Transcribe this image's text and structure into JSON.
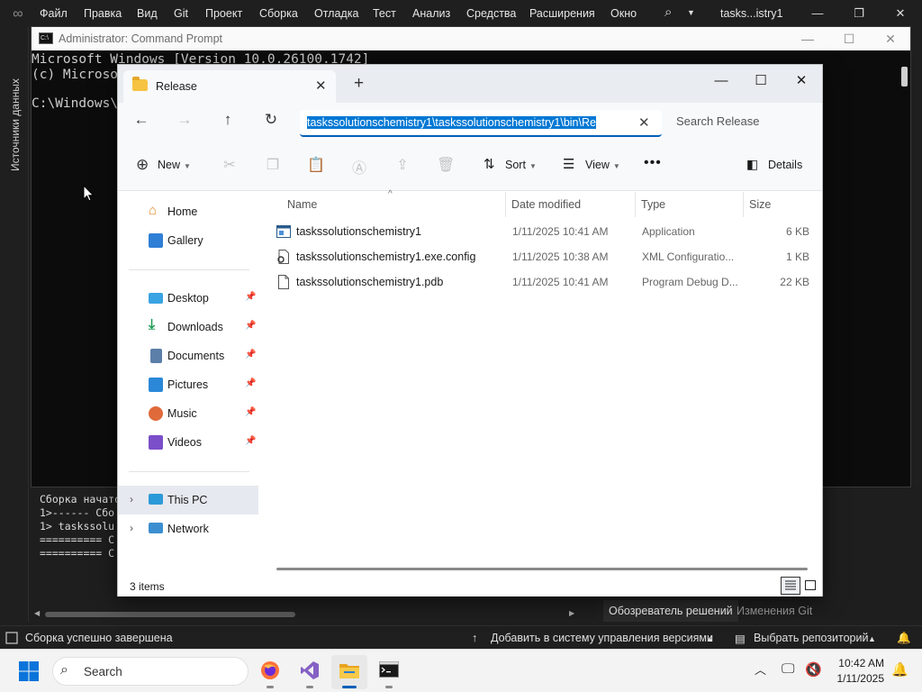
{
  "vs": {
    "menu": [
      "Файл",
      "Правка",
      "Вид",
      "Git",
      "Проект",
      "Сборка",
      "Отладка",
      "Тест",
      "Анализ",
      "Средства",
      "Расширения",
      "Окно"
    ],
    "title": "tasks...istry1",
    "side_panel_label": "Источники данных",
    "output_lines": [
      "Сборка начато",
      "1>------ Сбо",
      "1>  taskssolu",
      "========== С",
      "========== С"
    ],
    "right_tabs": [
      "Обозреватель решений",
      "Изменения Git"
    ],
    "statusbar": {
      "build_status": "Сборка успешно завершена",
      "add_to_vcs": "Добавить в систему управления версиями",
      "select_repo": "Выбрать репозиторий"
    }
  },
  "cmd": {
    "title": "Administrator: Command Prompt",
    "lines": [
      "Microsoft Windows [Version 10.0.26100.1742]",
      "(c) Microsoft",
      "",
      "C:\\Windows\\S"
    ]
  },
  "explorer": {
    "tab_title": "Release",
    "address_text": "taskssolutionschemistry1\\taskssolutionschemistry1\\bin\\Re",
    "search_placeholder": "Search Release",
    "commands": {
      "new": "New",
      "sort": "Sort",
      "view": "View",
      "details": "Details"
    },
    "nav": {
      "home": "Home",
      "gallery": "Gallery",
      "pinned": [
        "Desktop",
        "Downloads",
        "Documents",
        "Pictures",
        "Music",
        "Videos"
      ],
      "this_pc": "This PC",
      "network": "Network"
    },
    "columns": {
      "name": "Name",
      "date": "Date modified",
      "type": "Type",
      "size": "Size"
    },
    "files": [
      {
        "name": "taskssolutionschemistry1",
        "date": "1/11/2025 10:41 AM",
        "type": "Application",
        "size": "6 KB"
      },
      {
        "name": "taskssolutionschemistry1.exe.config",
        "date": "1/11/2025 10:38 AM",
        "type": "XML Configuratio...",
        "size": "1 KB"
      },
      {
        "name": "taskssolutionschemistry1.pdb",
        "date": "1/11/2025 10:41 AM",
        "type": "Program Debug D...",
        "size": "22 KB"
      }
    ],
    "status_count": "3 items"
  },
  "taskbar": {
    "search_placeholder": "Search",
    "time": "10:42 AM",
    "date": "1/11/2025"
  }
}
